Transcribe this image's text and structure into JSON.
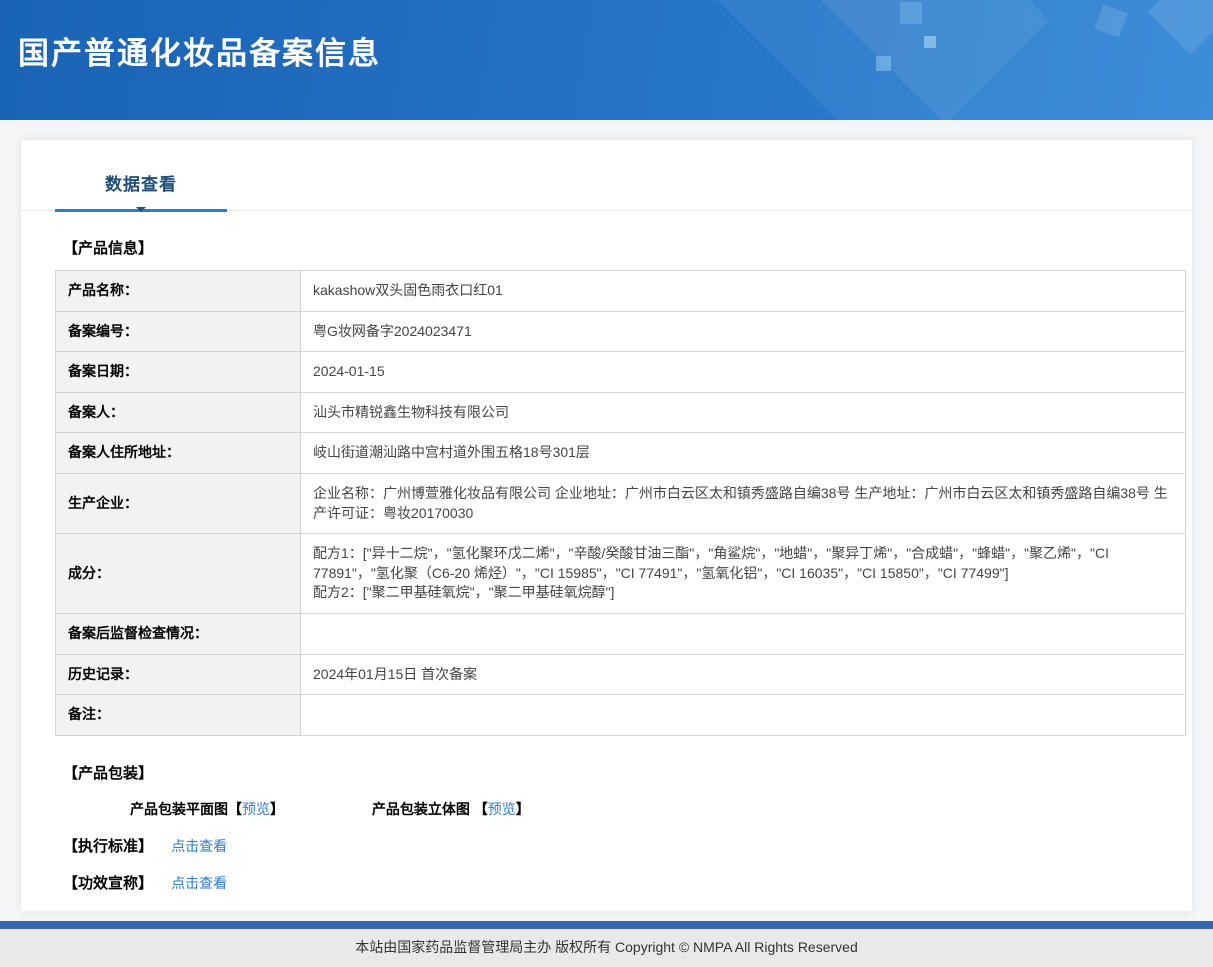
{
  "header": {
    "title": "国产普通化妆品备案信息"
  },
  "tabs": [
    {
      "label": "数据查看"
    }
  ],
  "sections": {
    "product_info": "【产品信息】",
    "packaging": "【产品包装】"
  },
  "product_info": {
    "rows": [
      {
        "label": "产品名称：",
        "value": "kakashow双头固色雨衣口红01"
      },
      {
        "label": "备案编号：",
        "value": "粤G妆网备字2024023471"
      },
      {
        "label": "备案日期：",
        "value": "2024-01-15"
      },
      {
        "label": "备案人：",
        "value": "汕头市精锐鑫生物科技有限公司"
      },
      {
        "label": "备案人住所地址：",
        "value": "岐山街道潮汕路中宫村道外围五格18号301层"
      },
      {
        "label": "生产企业：",
        "value": "企业名称：广州博萱雅化妆品有限公司 企业地址：广州市白云区太和镇秀盛路自编38号 生产地址：广州市白云区太和镇秀盛路自编38号 生产许可证：粤妆20170030"
      },
      {
        "label": "成分：",
        "value": "配方1：[\"异十二烷\"，\"氢化聚环戊二烯\"，\"辛酸/癸酸甘油三酯\"，\"角鲨烷\"，\"地蜡\"，\"聚异丁烯\"，\"合成蜡\"，\"蜂蜡\"，\"聚乙烯\"，\"CI 77891\"，\"氢化聚（C6-20 烯烃）\"，\"CI 15985\"，\"CI 77491\"，\"氢氧化铝\"，\"CI 16035\"，\"CI 15850\"，\"CI 77499\"]\n配方2：[\"聚二甲基硅氧烷\"，\"聚二甲基硅氧烷醇\"]"
      },
      {
        "label": "备案后监督检查情况：",
        "value": ""
      },
      {
        "label": "历史记录：",
        "value": "2024年01月15日 首次备案"
      },
      {
        "label": "备注：",
        "value": ""
      }
    ]
  },
  "packaging": {
    "items": [
      {
        "prefix": "产品包装平面图【",
        "link": "预览",
        "suffix": "】"
      },
      {
        "prefix": "产品包装立体图 【",
        "link": "预览",
        "suffix": "】"
      }
    ]
  },
  "standards": {
    "title": "【执行标准】",
    "link": "点击查看"
  },
  "efficacy": {
    "title": "【功效宣称】",
    "link": "点击查看"
  },
  "footer": {
    "text": "本站由国家药品监督管理局主办 版权所有 Copyright © NMPA All Rights Reserved"
  },
  "colors": {
    "header_gradient_start": "#1a63b5",
    "header_gradient_end": "#2f85d6",
    "accent_blue": "#2e7bd0",
    "link_blue": "#2e7bd0",
    "tab_text": "#1f4e79",
    "footer_bar": "#3a66b0",
    "label_cell_bg": "#f2f2f2"
  }
}
